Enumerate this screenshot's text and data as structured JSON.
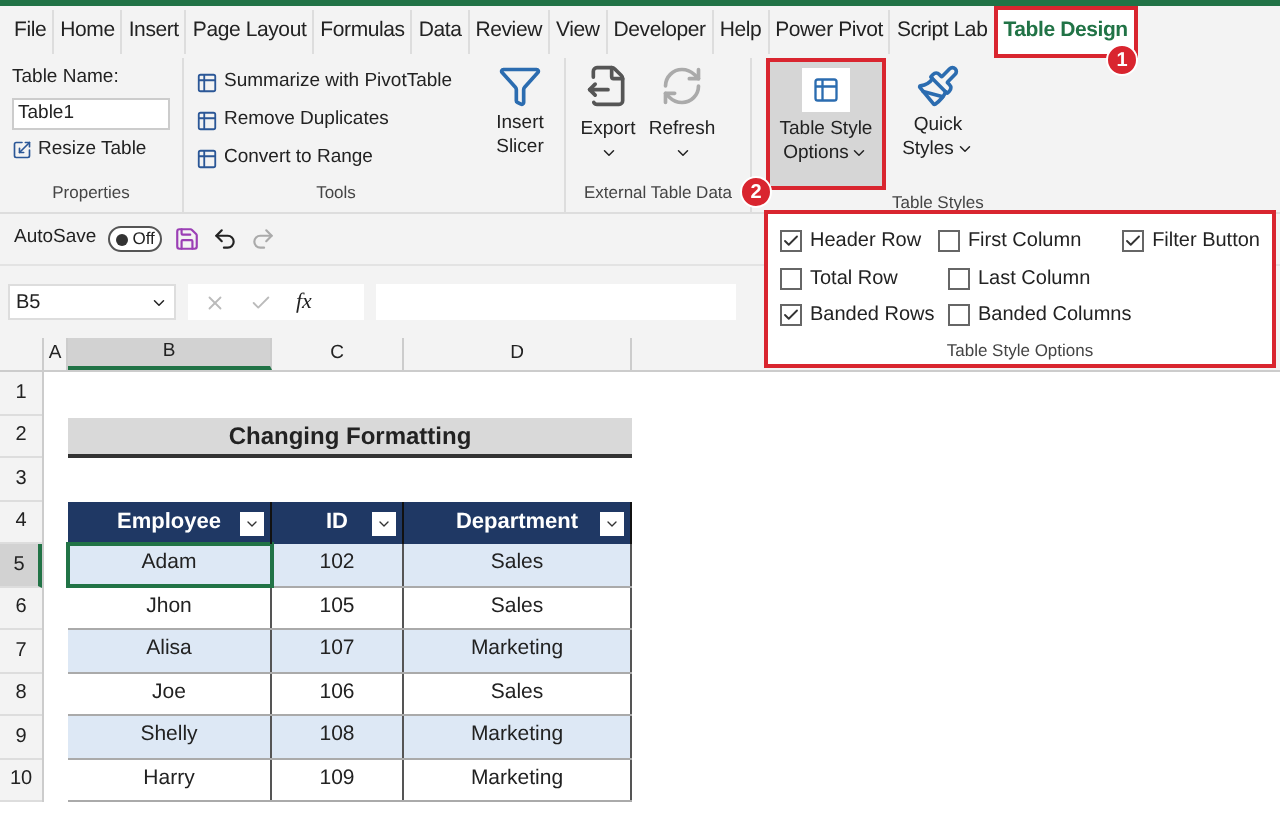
{
  "tabs": [
    {
      "label": "File",
      "selected": false
    },
    {
      "label": "Home",
      "selected": false
    },
    {
      "label": "Insert",
      "selected": false
    },
    {
      "label": "Page Layout",
      "selected": false
    },
    {
      "label": "Formulas",
      "selected": false
    },
    {
      "label": "Data",
      "selected": false
    },
    {
      "label": "Review",
      "selected": false
    },
    {
      "label": "View",
      "selected": false
    },
    {
      "label": "Developer",
      "selected": false
    },
    {
      "label": "Help",
      "selected": false
    },
    {
      "label": "Power Pivot",
      "selected": false
    },
    {
      "label": "Script Lab",
      "selected": false
    },
    {
      "label": "Table Design",
      "selected": true
    }
  ],
  "callouts": [
    "1",
    "2"
  ],
  "ribbon": {
    "properties": {
      "label": "Table Name:",
      "value": "Table1",
      "resize": "Resize Table",
      "group": "Properties"
    },
    "tools": {
      "items": [
        "Summarize with PivotTable",
        "Remove Duplicates",
        "Convert to Range"
      ],
      "slicer": "Insert Slicer",
      "group": "Tools"
    },
    "external": {
      "export": "Export",
      "refresh": "Refresh",
      "group": "External Table Data"
    },
    "style_options_button": "Table Style Options",
    "quick_styles": "Quick Styles",
    "styles_group": "Table Styles"
  },
  "style_options": {
    "rows": [
      [
        {
          "label": "Header Row",
          "checked": true
        },
        {
          "label": "First Column",
          "checked": false
        },
        {
          "label": "Filter Button",
          "checked": true
        }
      ],
      [
        {
          "label": "Total Row",
          "checked": false
        },
        {
          "label": "Last Column",
          "checked": false
        }
      ],
      [
        {
          "label": "Banded Rows",
          "checked": true
        },
        {
          "label": "Banded Columns",
          "checked": false
        }
      ]
    ],
    "group": "Table Style Options"
  },
  "quick_access": {
    "autosave": "AutoSave",
    "toggle": {
      "label": "Off",
      "on": false
    }
  },
  "formula_bar": {
    "name_box": "B5",
    "fx": "fx"
  },
  "columns": [
    {
      "label": "A",
      "selected": false
    },
    {
      "label": "B",
      "selected": true
    },
    {
      "label": "C",
      "selected": false
    },
    {
      "label": "D",
      "selected": false
    }
  ],
  "row_numbers": [
    {
      "label": "1",
      "selected": false
    },
    {
      "label": "2",
      "selected": false
    },
    {
      "label": "3",
      "selected": false
    },
    {
      "label": "4",
      "selected": false
    },
    {
      "label": "5",
      "selected": true
    },
    {
      "label": "6",
      "selected": false
    },
    {
      "label": "7",
      "selected": false
    },
    {
      "label": "8",
      "selected": false
    },
    {
      "label": "9",
      "selected": false
    },
    {
      "label": "10",
      "selected": false
    }
  ],
  "sheet": {
    "title": "Changing Formatting",
    "headers": [
      "Employee",
      "ID",
      "Department"
    ],
    "rows": [
      [
        "Adam",
        "102",
        "Sales"
      ],
      [
        "Jhon",
        "105",
        "Sales"
      ],
      [
        "Alisa",
        "107",
        "Marketing"
      ],
      [
        "Joe",
        "106",
        "Sales"
      ],
      [
        "Shelly",
        "108",
        "Marketing"
      ],
      [
        "Harry",
        "109",
        "Marketing"
      ]
    ]
  }
}
